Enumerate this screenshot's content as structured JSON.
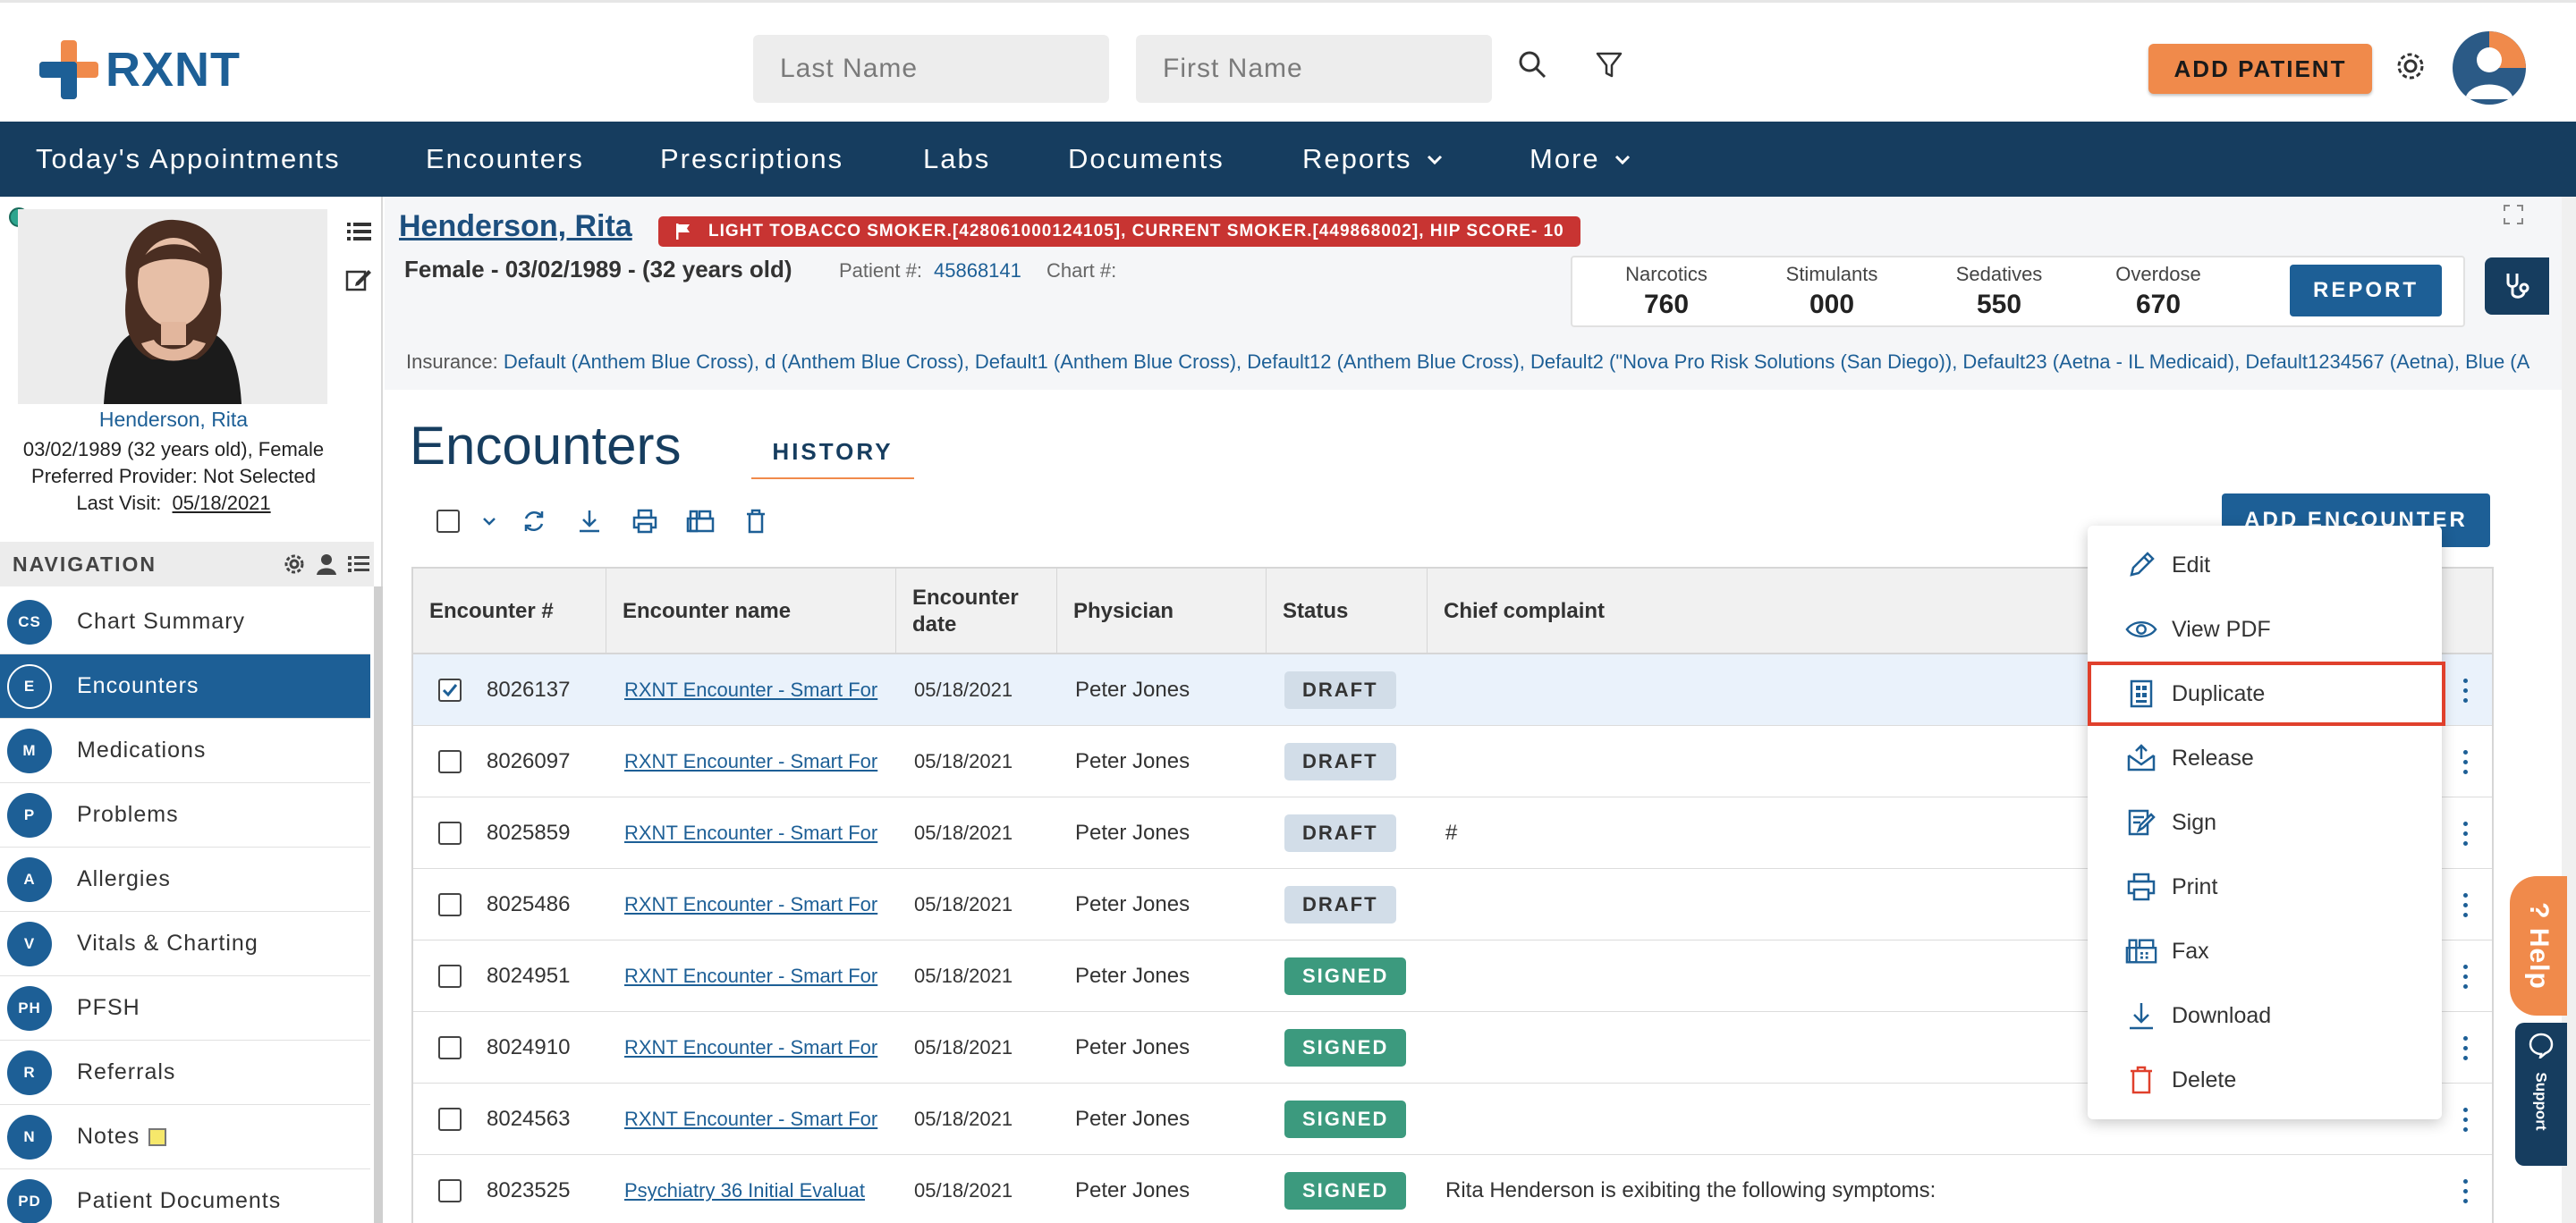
{
  "brand": {
    "name": "RXNT"
  },
  "search": {
    "last_name_placeholder": "Last Name",
    "first_name_placeholder": "First Name"
  },
  "header": {
    "add_patient_label": "ADD PATIENT"
  },
  "mainnav": {
    "items": [
      {
        "label": "Today's Appointments"
      },
      {
        "label": "Encounters"
      },
      {
        "label": "Prescriptions"
      },
      {
        "label": "Labs"
      },
      {
        "label": "Documents"
      },
      {
        "label": "Reports"
      },
      {
        "label": "More"
      }
    ]
  },
  "patient": {
    "name": "Henderson, Rita",
    "alert": "LIGHT TOBACCO SMOKER.[428061000124105], CURRENT SMOKER.[449868002], HIP SCORE- 10",
    "demographics": "Female - 03/02/1989 - (32 years old)",
    "patient_num_label": "Patient #:",
    "patient_num": "45868141",
    "chart_num_label": "Chart #:",
    "insurance_label": "Insurance:",
    "insurance": "Default (Anthem Blue Cross), d (Anthem Blue Cross), Default1 (Anthem Blue Cross), Default12 (Anthem Blue Cross), Default2 (\"Nova Pro Risk Solutions (San Diego)), Default23 (Aetna - IL Medicaid), Default1234567 (Aetna), Blue (A",
    "sidebar_name": "Henderson, Rita",
    "sidebar_dob": "03/02/1989 (32 years old), Female",
    "preferred_provider": "Preferred Provider: Not Selected",
    "last_visit_label": "Last Visit:",
    "last_visit": "05/18/2021"
  },
  "risk": [
    {
      "label": "Narcotics",
      "value": "760"
    },
    {
      "label": "Stimulants",
      "value": "000"
    },
    {
      "label": "Sedatives",
      "value": "550"
    },
    {
      "label": "Overdose",
      "value": "670"
    }
  ],
  "report_label": "REPORT",
  "sidenav": {
    "header": "NAVIGATION",
    "items": [
      {
        "badge": "CS",
        "label": "Chart Summary"
      },
      {
        "badge": "E",
        "label": "Encounters"
      },
      {
        "badge": "M",
        "label": "Medications"
      },
      {
        "badge": "P",
        "label": "Problems"
      },
      {
        "badge": "A",
        "label": "Allergies"
      },
      {
        "badge": "V",
        "label": "Vitals & Charting"
      },
      {
        "badge": "PH",
        "label": "PFSH"
      },
      {
        "badge": "R",
        "label": "Referrals"
      },
      {
        "badge": "N",
        "label": "Notes"
      },
      {
        "badge": "PD",
        "label": "Patient Documents"
      }
    ]
  },
  "encounters": {
    "title": "Encounters",
    "tab_history": "HISTORY",
    "add_encounter_label": "ADD ENCOUNTER",
    "columns": [
      "Encounter #",
      "Encounter name",
      "Encounter date",
      "Physician",
      "Status",
      "Chief complaint"
    ],
    "rows": [
      {
        "num": "8026137",
        "name": "RXNT Encounter - Smart For",
        "date": "05/18/2021",
        "physician": "Peter Jones",
        "status": "DRAFT",
        "complaint": "",
        "checked": true
      },
      {
        "num": "8026097",
        "name": "RXNT Encounter - Smart For",
        "date": "05/18/2021",
        "physician": "Peter Jones",
        "status": "DRAFT",
        "complaint": "",
        "checked": false
      },
      {
        "num": "8025859",
        "name": "RXNT Encounter - Smart For",
        "date": "05/18/2021",
        "physician": "Peter Jones",
        "status": "DRAFT",
        "complaint": "#",
        "checked": false
      },
      {
        "num": "8025486",
        "name": "RXNT Encounter - Smart For",
        "date": "05/18/2021",
        "physician": "Peter Jones",
        "status": "DRAFT",
        "complaint": "",
        "checked": false
      },
      {
        "num": "8024951",
        "name": "RXNT Encounter - Smart For",
        "date": "05/18/2021",
        "physician": "Peter Jones",
        "status": "SIGNED",
        "complaint": "",
        "checked": false
      },
      {
        "num": "8024910",
        "name": "RXNT Encounter - Smart For",
        "date": "05/18/2021",
        "physician": "Peter Jones",
        "status": "SIGNED",
        "complaint": "",
        "checked": false
      },
      {
        "num": "8024563",
        "name": "RXNT Encounter - Smart For",
        "date": "05/18/2021",
        "physician": "Peter Jones",
        "status": "SIGNED",
        "complaint": "",
        "checked": false
      },
      {
        "num": "8023525",
        "name": "Psychiatry 36 Initial Evaluat",
        "date": "05/18/2021",
        "physician": "Peter Jones",
        "status": "SIGNED",
        "complaint": "Rita Henderson is exibiting the following symptoms:",
        "checked": false
      }
    ]
  },
  "action_menu": {
    "items": [
      {
        "label": "Edit",
        "icon": "pencil-icon"
      },
      {
        "label": "View PDF",
        "icon": "eye-icon"
      },
      {
        "label": "Duplicate",
        "icon": "duplicate-icon"
      },
      {
        "label": "Release",
        "icon": "release-icon"
      },
      {
        "label": "Sign",
        "icon": "sign-icon"
      },
      {
        "label": "Print",
        "icon": "printer-icon"
      },
      {
        "label": "Fax",
        "icon": "fax-icon"
      },
      {
        "label": "Download",
        "icon": "download-icon"
      },
      {
        "label": "Delete",
        "icon": "trash-icon"
      }
    ],
    "highlighted": "Duplicate"
  },
  "help": {
    "label": "? Help",
    "support_label": "Support"
  },
  "colors": {
    "brand_blue": "#1d5f96",
    "nav_dark": "#163d5f",
    "accent_orange": "#f08a4b",
    "alert_red": "#c83432",
    "signed_green": "#3c9a7e",
    "draft_gray": "#d2dde8"
  }
}
